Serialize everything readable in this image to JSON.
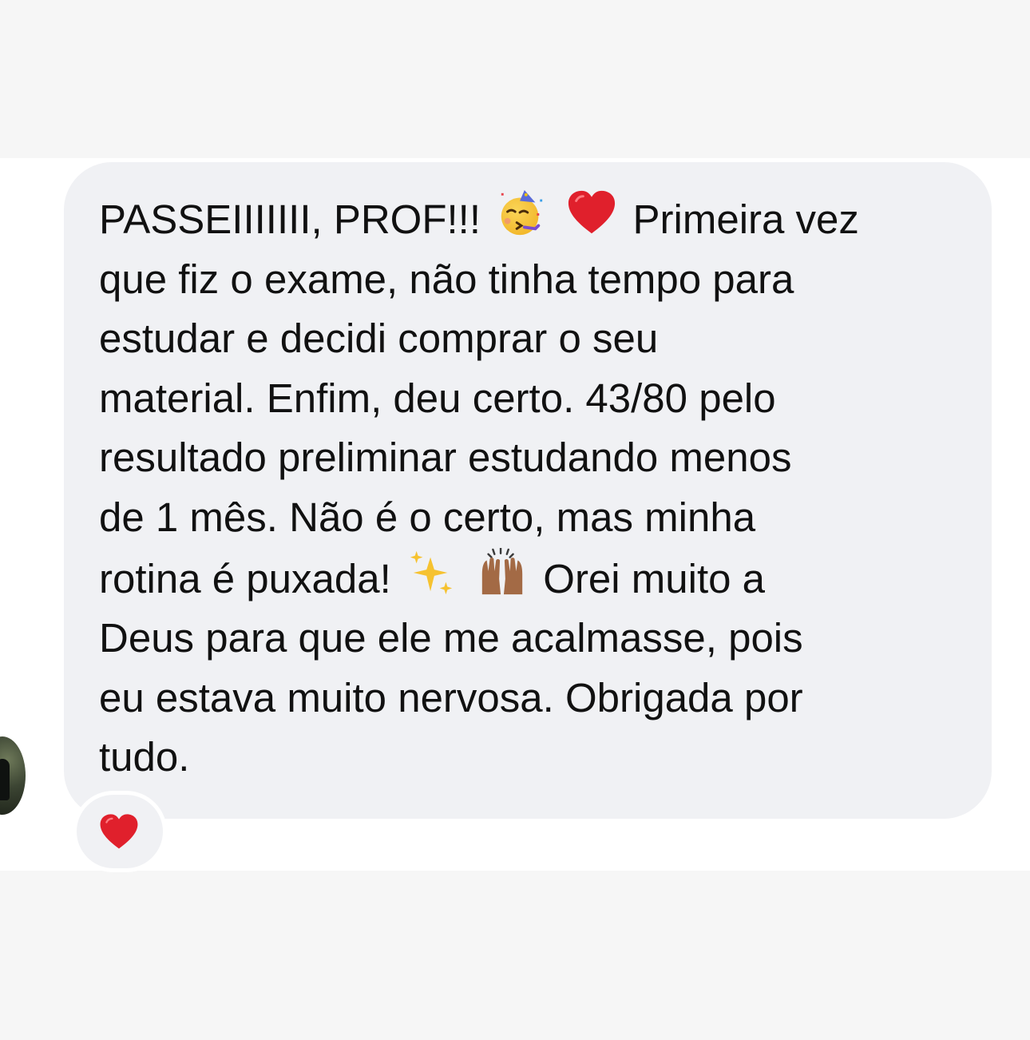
{
  "message": {
    "line_1_before": "PASSEIIIIIII, PROF!!!",
    "line_1_after": "Primeira vez",
    "line_2": "que fiz o exame, não tinha tempo para",
    "line_3": "estudar e decidi comprar o seu",
    "line_4": "material. Enfim, deu certo. 43/80 pelo",
    "line_5": "resultado preliminar estudando menos",
    "line_6": "de 1 mês. Não é o certo, mas minha",
    "line_7_before": "rotina é puxada!",
    "line_7_after": "Orei muito a",
    "line_8": "Deus para que ele me acalmasse, pois",
    "line_9": "eu estava muito nervosa. Obrigada por",
    "line_10": "tudo.",
    "emojis": [
      "partying-face-icon",
      "red-heart-icon",
      "sparkles-icon",
      "raising-hands-icon"
    ]
  },
  "reaction": {
    "emoji": "red-heart-icon"
  },
  "colors": {
    "background_band": "#f6f6f6",
    "bubble": "#f0f1f4",
    "text": "#111111",
    "heart": "#e0202c"
  }
}
